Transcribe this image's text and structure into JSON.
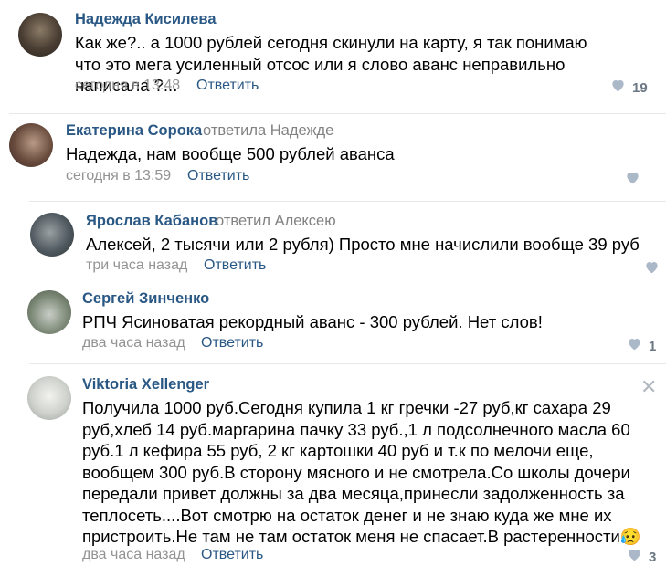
{
  "comments": [
    {
      "author": "Надежда Кисилева",
      "reply_to": "",
      "text": "Как же?.. а 1000 рублей сегодня скинули на карту, я так понимаю что это мега усиленный отсос или я слово аванс неправильно написала ?...",
      "time": "сегодня в 13:48",
      "reply_label": "Ответить",
      "likes": "19"
    },
    {
      "author": "Екатерина Сорока",
      "reply_to": "ответила Надежде",
      "text": "Надежда, нам вообще 500 рублей аванса",
      "time": "сегодня в 13:59",
      "reply_label": "Ответить",
      "likes": ""
    },
    {
      "author": "Ярослав Кабанов",
      "reply_to": "ответил Алексею",
      "text": "Алексей, 2 тысячи или 2 рубля) Просто мне начислили вообще 39 руб",
      "time": "три часа назад",
      "reply_label": "Ответить",
      "likes": ""
    },
    {
      "author": "Сергей Зинченко",
      "reply_to": "",
      "text": "РПЧ Ясиноватая рекордный аванс - 300 рублей. Нет слов!",
      "time": "два часа назад",
      "reply_label": "Ответить",
      "likes": "1"
    },
    {
      "author": "Viktoria Xellenger",
      "reply_to": "",
      "text": "Получила 1000 руб.Сегодня купила 1 кг гречки -27 руб,кг сахара 29 руб,хлеб 14 руб.маргарина пачку 33 руб.,1 л подсолнечного масла 60 руб.1 л кефира 55 руб, 2 кг картошки 40 руб и т.к по мелочи еще, вообщем 300 руб.В сторону мясного и не смотрела.Со школы дочери передали привет должны за два месяца,принесли задолженность за теплосеть....Вот смотрю на остаток денег и не знаю куда же мне их пристроить.Не там не там остаток меня не спасает.В растеренности😥",
      "time": "два часа назад",
      "reply_label": "Ответить",
      "likes": "3"
    }
  ],
  "colors": {
    "link": "#2a5885",
    "meta": "#939393",
    "like_icon": "#aab8c8",
    "divider": "#e7e8ec"
  },
  "icons": {
    "like": "heart-icon",
    "close": "close-icon"
  },
  "close_glyph": "✕"
}
